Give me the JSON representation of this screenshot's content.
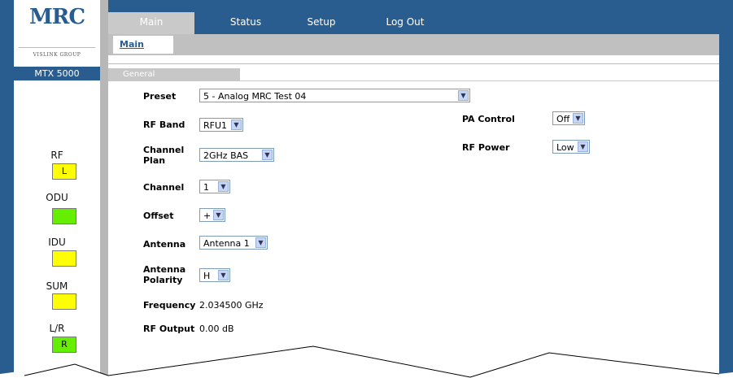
{
  "brand": {
    "logo_text": "MRC",
    "logo_sub": "VISLINK GROUP",
    "model": "MTX 5000"
  },
  "indicators": [
    {
      "label": "RF",
      "box_text": "L",
      "color": "#ffff00"
    },
    {
      "label": "ODU",
      "box_text": "",
      "color": "#66ee00"
    },
    {
      "label": "IDU",
      "box_text": "",
      "color": "#ffff00"
    },
    {
      "label": "SUM",
      "box_text": "",
      "color": "#ffff00"
    },
    {
      "label": "L/R",
      "box_text": "R",
      "color": "#66ee00"
    }
  ],
  "nav": {
    "tabs": [
      "Main",
      "Status",
      "Setup",
      "Log Out"
    ],
    "active": "Main",
    "subtab": "Main"
  },
  "section": {
    "title": "General"
  },
  "form": {
    "preset": {
      "label": "Preset",
      "value": "5 - Analog MRC Test 04"
    },
    "rf_band": {
      "label": "RF Band",
      "value": "RFU1"
    },
    "channel_plan": {
      "label_1": "Channel",
      "label_2": "Plan",
      "value": "2GHz BAS"
    },
    "channel": {
      "label": "Channel",
      "value": "1"
    },
    "offset": {
      "label": "Offset",
      "value": "+"
    },
    "antenna": {
      "label": "Antenna",
      "value": "Antenna 1"
    },
    "antenna_polarity": {
      "label_1": "Antenna",
      "label_2": "Polarity",
      "value": "H"
    },
    "frequency": {
      "label": "Frequency",
      "value": "2.034500 GHz"
    },
    "rf_output": {
      "label": "RF Output",
      "value": "0.00 dB"
    },
    "pa_control": {
      "label": "PA Control",
      "value": "Off"
    },
    "rf_power": {
      "label": "RF Power",
      "value": "Low"
    }
  },
  "icons": {
    "dropdown": "chevron-down-icon"
  }
}
